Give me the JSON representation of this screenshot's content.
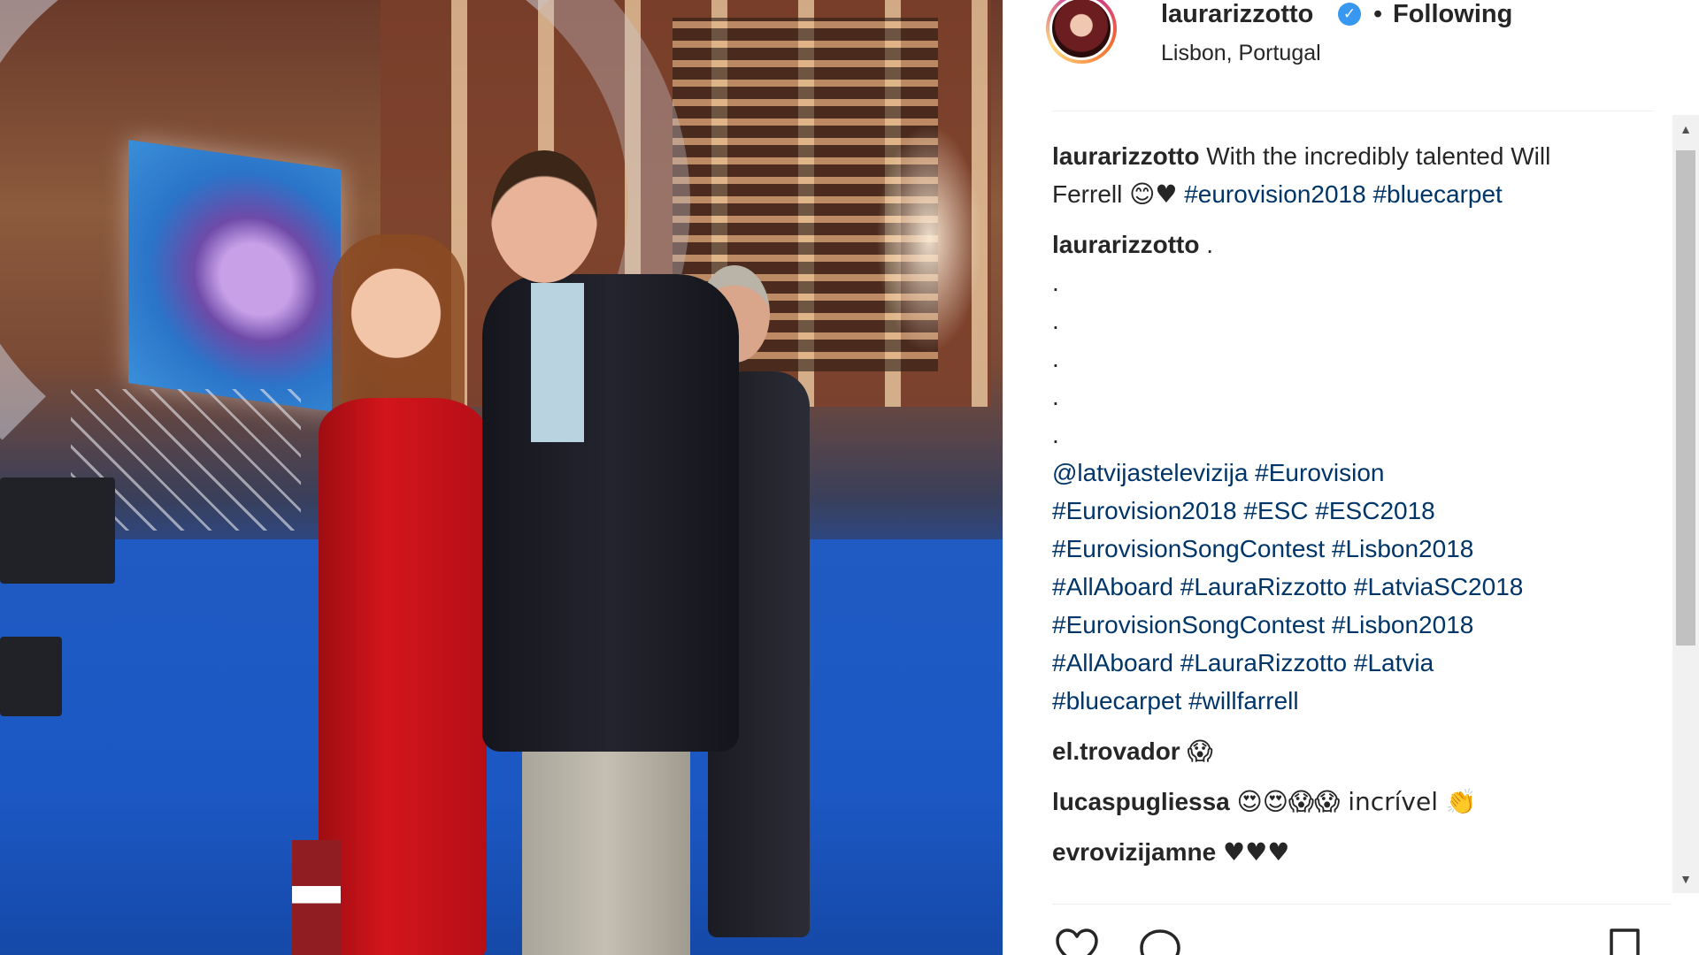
{
  "post": {
    "username": "laurarizzotto",
    "verified_symbol": "✓",
    "separator": "•",
    "follow_status": "Following",
    "location": "Lisbon, Portugal"
  },
  "caption": {
    "user": "laurarizzotto",
    "text": "With the incredibly talented Will Ferrell",
    "emoji": "😊♥",
    "hashtags": [
      "#eurovision2018",
      "#bluecarpet"
    ]
  },
  "follow_comment": {
    "user": "laurarizzotto",
    "first_line": ".",
    "dots": [
      ".",
      ".",
      ".",
      ".",
      "."
    ],
    "tag_lines": [
      "@latvijastelevizija #Eurovision",
      "#Eurovision2018 #ESC #ESC2018",
      "#EurovisionSongContest #Lisbon2018",
      "#AllAboard #LauraRizzotto #LatviaSC2018",
      "#EurovisionSongContest #Lisbon2018",
      "#AllAboard #LauraRizzotto #Latvia",
      "#bluecarpet #willfarrell"
    ]
  },
  "comments": [
    {
      "user": "el.trovador",
      "text": "😱"
    },
    {
      "user": "lucaspugliessa",
      "text": "😍😍😱😱 incrível 👏"
    },
    {
      "user": "evrovizijamne",
      "text": "♥♥♥"
    }
  ],
  "icons": {
    "like": "heart-icon",
    "comment": "comment-icon",
    "save": "bookmark-icon",
    "scroll_up": "▲",
    "scroll_down": "▼"
  },
  "colors": {
    "text": "#262626",
    "hashtag": "#003569",
    "verified": "#3897f0",
    "divider": "#efefef"
  }
}
